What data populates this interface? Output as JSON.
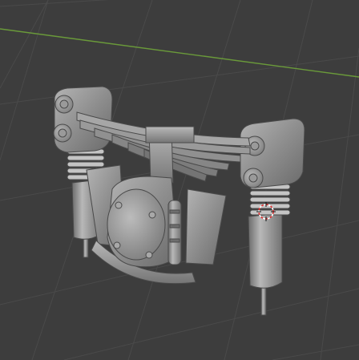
{
  "viewport": {
    "mode": "3d-viewport",
    "background_color": "#3d3d3d",
    "grid_line_color": "#4a4a4a",
    "x_axis_color": "#6a9a3a",
    "object": {
      "type": "mesh",
      "description_icon": "leaf-spring-suspension-model",
      "base_color": "#8c8c8c",
      "shadow_color": "#5e5e5e",
      "highlight_color": "#bdbdbd"
    },
    "cursor": {
      "icon": "3d-cursor-icon",
      "color_primary": "#e03030",
      "color_secondary": "#ffffff"
    }
  }
}
